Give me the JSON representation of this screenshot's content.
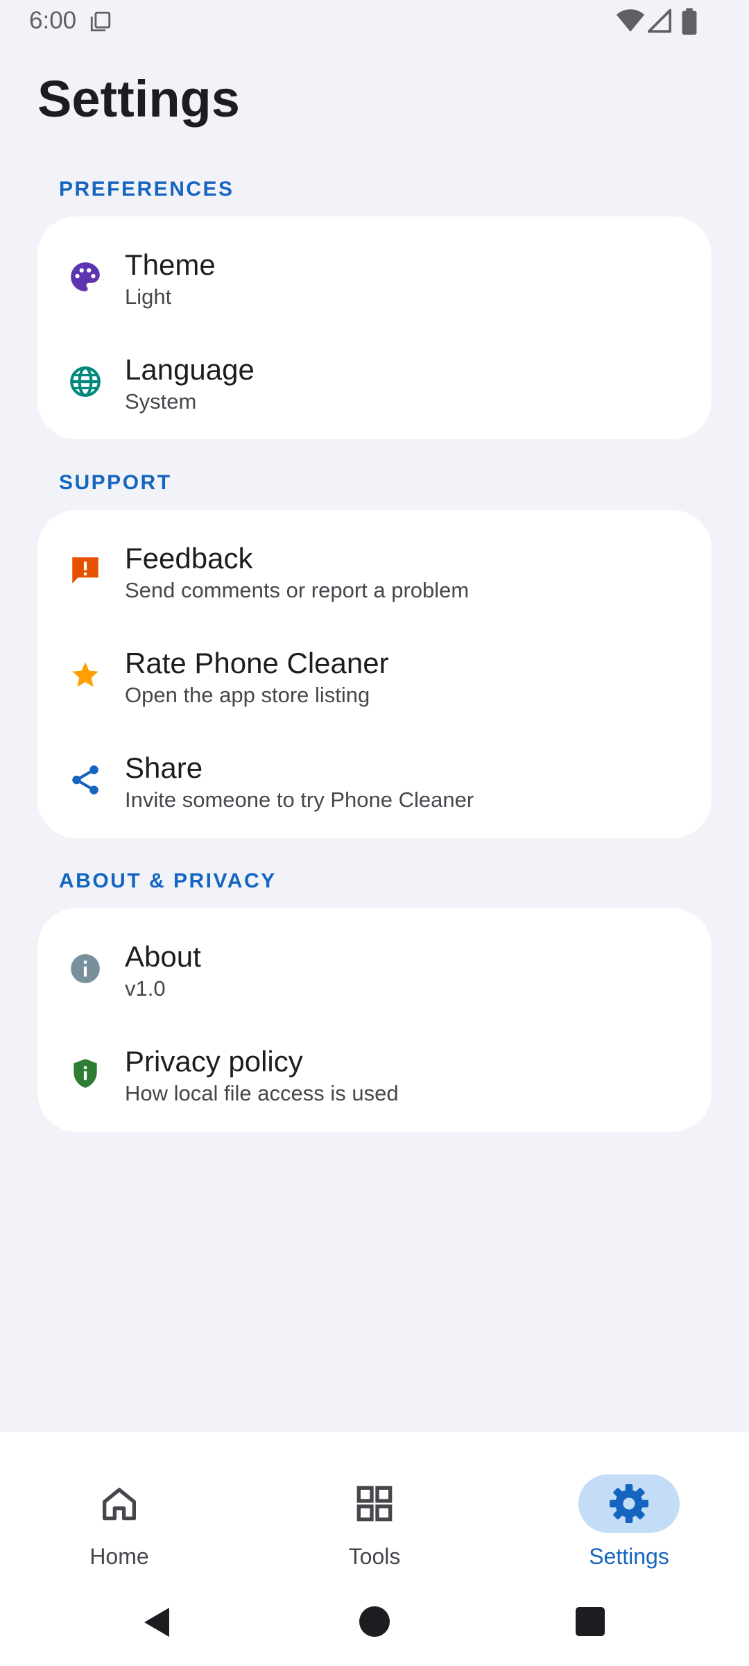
{
  "status_bar": {
    "time": "6:00",
    "icons": [
      "sim-card-icon",
      "wifi-icon",
      "cell-signal-icon",
      "battery-icon"
    ]
  },
  "page": {
    "title": "Settings"
  },
  "sections": [
    {
      "label": "PREFERENCES",
      "items": [
        {
          "title": "Theme",
          "subtitle": "Light",
          "icon": "palette-icon",
          "icon_color": "#5E35B1"
        },
        {
          "title": "Language",
          "subtitle": "System",
          "icon": "globe-icon",
          "icon_color": "#00897B"
        }
      ]
    },
    {
      "label": "SUPPORT",
      "items": [
        {
          "title": "Feedback",
          "subtitle": "Send comments or report a problem",
          "icon": "feedback-icon",
          "icon_color": "#E65100"
        },
        {
          "title": "Rate Phone Cleaner",
          "subtitle": "Open the app store listing",
          "icon": "star-icon",
          "icon_color": "#FFA000"
        },
        {
          "title": "Share",
          "subtitle": "Invite someone to try Phone Cleaner",
          "icon": "share-icon",
          "icon_color": "#1565C0"
        }
      ]
    },
    {
      "label": "ABOUT & PRIVACY",
      "items": [
        {
          "title": "About",
          "subtitle": "v1.0",
          "icon": "info-icon",
          "icon_color": "#78909C"
        },
        {
          "title": "Privacy policy",
          "subtitle": "How local file access is used",
          "icon": "shield-icon",
          "icon_color": "#2E7D32"
        }
      ]
    }
  ],
  "bottom_nav": {
    "items": [
      {
        "label": "Home",
        "icon": "home-icon",
        "active": false
      },
      {
        "label": "Tools",
        "icon": "grid-icon",
        "active": false
      },
      {
        "label": "Settings",
        "icon": "gear-icon",
        "active": true
      }
    ]
  },
  "colors": {
    "background": "#F1F3F8",
    "card": "#FFFFFF",
    "accent": "#1565C0",
    "active_pill": "#C3DDF7"
  }
}
